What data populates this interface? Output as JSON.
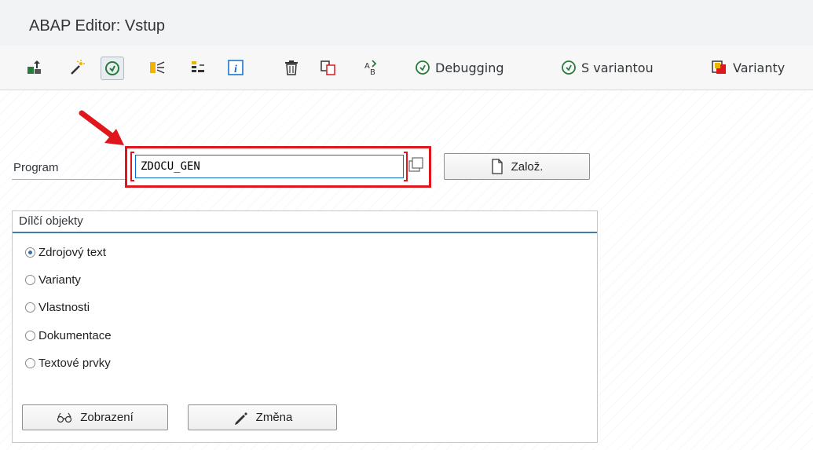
{
  "window": {
    "title": "ABAP Editor: Vstup"
  },
  "toolbar": {
    "icons": [
      "other-object-icon",
      "wizard-icon",
      "execute-icon",
      "where-used-icon",
      "object-list-icon",
      "info-icon",
      "delete-icon",
      "copy-icon",
      "rename-icon"
    ],
    "debugging_label": "Debugging",
    "with_variant_label": "S variantou",
    "variants_label": "Varianty"
  },
  "program": {
    "label": "Program",
    "value": "ZDOCU_GEN",
    "create_label": "Založ."
  },
  "subobjects": {
    "title": "Dílčí objekty",
    "options": [
      {
        "label": "Zdrojový text",
        "checked": true
      },
      {
        "label": "Varianty",
        "checked": false
      },
      {
        "label": "Vlastnosti",
        "checked": false
      },
      {
        "label": "Dokumentace",
        "checked": false
      },
      {
        "label": "Textové prvky",
        "checked": false
      }
    ],
    "display_label": "Zobrazení",
    "change_label": "Změna"
  },
  "colors": {
    "highlight": "#e0161d",
    "accent": "#427cac",
    "execute_green": "#2b7a3d"
  }
}
